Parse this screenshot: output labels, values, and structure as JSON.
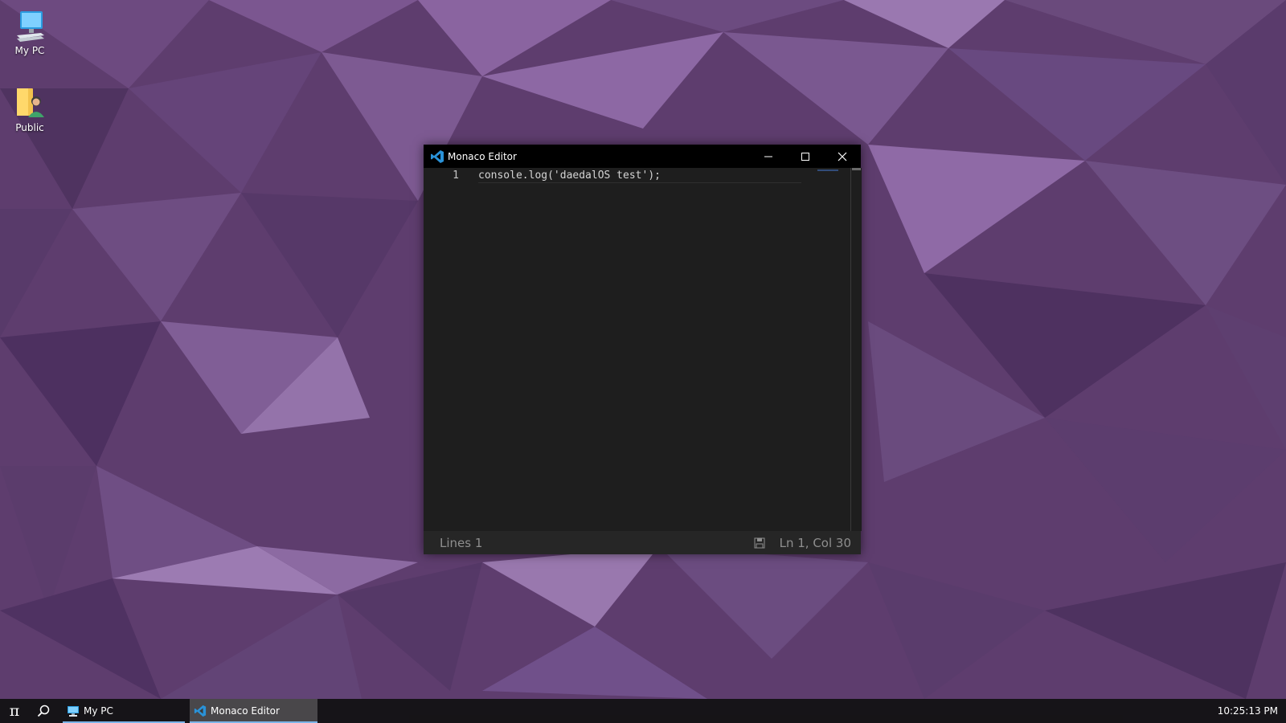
{
  "desktop": {
    "icons": [
      {
        "label": "My PC"
      },
      {
        "label": "Public"
      }
    ]
  },
  "window": {
    "title": "Monaco Editor",
    "editor": {
      "line_numbers": [
        "1"
      ],
      "lines": [
        "console.log('daedalOS test');"
      ]
    },
    "status": {
      "lines_label": "Lines 1",
      "position": "Ln 1, Col 30"
    }
  },
  "taskbar": {
    "start_glyph": "π",
    "entries": [
      {
        "label": "My PC"
      },
      {
        "label": "Monaco Editor"
      }
    ],
    "clock": "10:25:13 PM"
  },
  "colors": {
    "wallpaper_base": "#5e3d6e",
    "vscode_blue": "#2a92d8",
    "taskbar_underline": "#7bb4e8"
  }
}
